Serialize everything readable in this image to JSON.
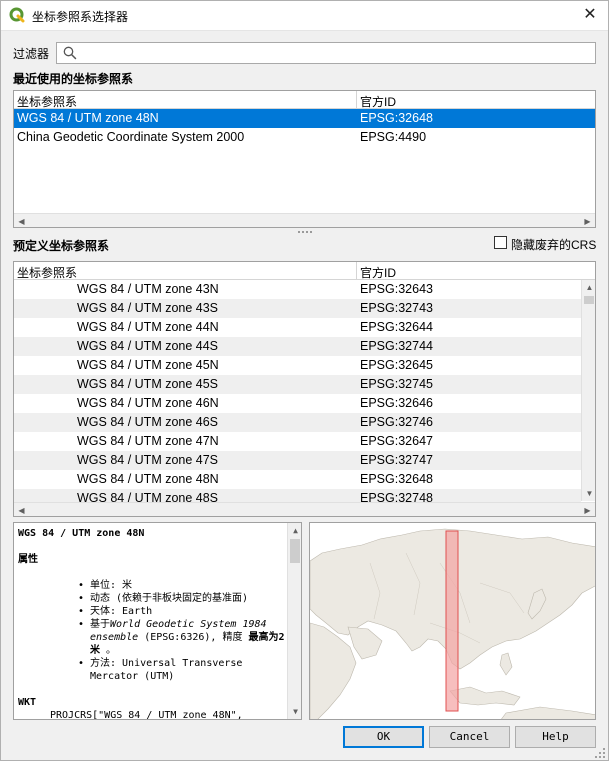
{
  "window": {
    "title": "坐标参照系选择器",
    "close_glyph": "✕",
    "app_icon": "qgis-logo-icon"
  },
  "filter": {
    "label": "过滤器",
    "value": "",
    "placeholder": ""
  },
  "recent": {
    "title": "最近使用的坐标参照系",
    "columns": [
      "坐标参照系",
      "官方ID"
    ],
    "rows": [
      {
        "name": "WGS 84 / UTM zone 48N",
        "id": "EPSG:32648",
        "selected": true
      },
      {
        "name": "China Geodetic Coordinate System 2000",
        "id": "EPSG:4490",
        "selected": false
      }
    ]
  },
  "predefined": {
    "title": "预定义坐标参照系",
    "hide_deprecated_label": "隐藏废弃的CRS",
    "hide_deprecated_checked": false,
    "columns": [
      "坐标参照系",
      "官方ID"
    ],
    "rows": [
      {
        "name": "WGS 84 / UTM zone 43N",
        "id": "EPSG:32643"
      },
      {
        "name": "WGS 84 / UTM zone 43S",
        "id": "EPSG:32743"
      },
      {
        "name": "WGS 84 / UTM zone 44N",
        "id": "EPSG:32644"
      },
      {
        "name": "WGS 84 / UTM zone 44S",
        "id": "EPSG:32744"
      },
      {
        "name": "WGS 84 / UTM zone 45N",
        "id": "EPSG:32645"
      },
      {
        "name": "WGS 84 / UTM zone 45S",
        "id": "EPSG:32745"
      },
      {
        "name": "WGS 84 / UTM zone 46N",
        "id": "EPSG:32646"
      },
      {
        "name": "WGS 84 / UTM zone 46S",
        "id": "EPSG:32746"
      },
      {
        "name": "WGS 84 / UTM zone 47N",
        "id": "EPSG:32647"
      },
      {
        "name": "WGS 84 / UTM zone 47S",
        "id": "EPSG:32747"
      },
      {
        "name": "WGS 84 / UTM zone 48N",
        "id": "EPSG:32648"
      },
      {
        "name": "WGS 84 / UTM zone 48S",
        "id": "EPSG:32748"
      }
    ]
  },
  "details": {
    "crs_name": "WGS 84 / UTM zone 48N",
    "properties_heading": "属性",
    "unit": "单位: 米",
    "dynamic": "动态 (依赖于非板块固定的基准面)",
    "celestial": "天体: Earth",
    "based_on_prefix": "基于",
    "based_on_italic": "World Geodetic System 1984 ensemble",
    "based_on_code": " (EPSG:6326), 精度 ",
    "accuracy": "最高为2米",
    "accuracy_suffix": " 。",
    "method": "方法: Universal Transverse Mercator (UTM)",
    "wkt_heading": "WKT",
    "wkt_line": "PROJCRS[\"WGS 84 / UTM zone 48N\","
  },
  "buttons": {
    "ok": "OK",
    "cancel": "Cancel",
    "help": "Help"
  },
  "colors": {
    "selection": "#0078d7",
    "extent_fill": "#f4a3a3",
    "extent_stroke": "#e05050",
    "land": "#ece9e2"
  }
}
